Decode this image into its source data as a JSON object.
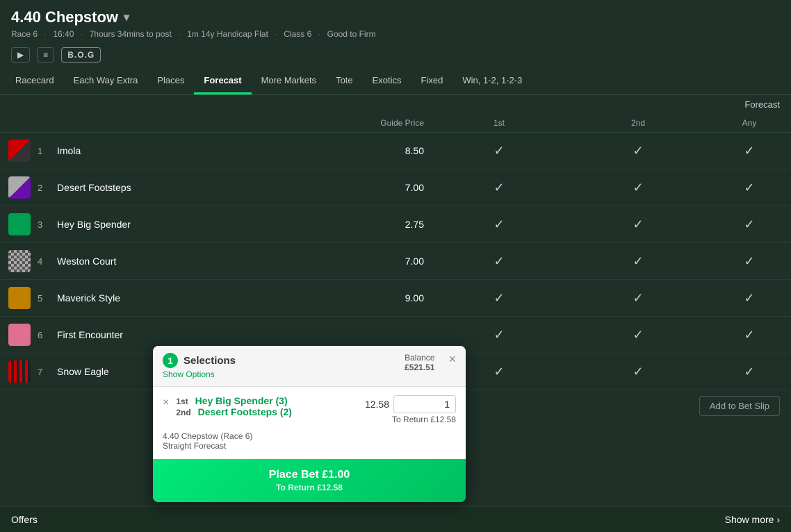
{
  "header": {
    "title": "4.40 Chepstow",
    "dropdown_icon": "▾",
    "meta": {
      "race": "Race 6",
      "time": "16:40",
      "countdown": "7hours 34mins to post",
      "distance": "1m 14y Handicap Flat",
      "class": "Class 6",
      "going": "Good to Firm"
    }
  },
  "action_icons": {
    "video_label": "▶",
    "racecard_label": "🗒",
    "bog_label": "B.O.G"
  },
  "nav": {
    "tabs": [
      {
        "id": "racecard",
        "label": "Racecard",
        "active": false
      },
      {
        "id": "eachway",
        "label": "Each Way Extra",
        "active": false
      },
      {
        "id": "places",
        "label": "Places",
        "active": false
      },
      {
        "id": "forecast",
        "label": "Forecast",
        "active": true
      },
      {
        "id": "moremarkets",
        "label": "More Markets",
        "active": false
      },
      {
        "id": "tote",
        "label": "Tote",
        "active": false
      },
      {
        "id": "exotics",
        "label": "Exotics",
        "active": false
      },
      {
        "id": "fixed",
        "label": "Fixed",
        "active": false
      },
      {
        "id": "win123",
        "label": "Win, 1-2, 1-2-3",
        "active": false
      }
    ]
  },
  "forecast_section": {
    "label": "Forecast",
    "columns": {
      "guide_price": "Guide Price",
      "first": "1st",
      "second": "2nd",
      "any": "Any"
    }
  },
  "horses": [
    {
      "num": 1,
      "name": "Imola",
      "guide_price": "8.50",
      "silk_class": "silk-1"
    },
    {
      "num": 2,
      "name": "Desert Footsteps",
      "guide_price": "7.00",
      "silk_class": "silk-2"
    },
    {
      "num": 3,
      "name": "Hey Big Spender",
      "guide_price": "2.75",
      "silk_class": "silk-3"
    },
    {
      "num": 4,
      "name": "Weston Court",
      "guide_price": "7.00",
      "silk_class": "silk-4"
    },
    {
      "num": 5,
      "name": "Maverick Style",
      "guide_price": "9.00",
      "silk_class": "silk-5"
    },
    {
      "num": 6,
      "name": "First Encounter",
      "guide_price": "",
      "silk_class": "silk-6"
    },
    {
      "num": 7,
      "name": "Snow Eagle",
      "guide_price": "",
      "silk_class": "silk-7"
    }
  ],
  "bet_slip": {
    "selections_count": "1",
    "selections_label": "Selections",
    "show_options_label": "Show Options",
    "balance_label": "Balance",
    "balance_amount": "£521.51",
    "close_icon": "×",
    "remove_icon": "×",
    "first_position": "1st",
    "first_horse": "Hey Big Spender (3)",
    "odds": "12.58",
    "stake": "1",
    "second_position": "2nd",
    "second_horse": "Desert Footsteps (2)",
    "to_return_label": "To Return £12.58",
    "race_label": "4.40 Chepstow (Race 6)",
    "bet_type": "Straight Forecast",
    "place_bet_label": "Place Bet  £1.00",
    "place_bet_return": "To Return £12.58"
  },
  "add_betslip_label": "Add to Bet Slip",
  "offers": {
    "label": "Offers",
    "show_more": "Show more ›"
  }
}
